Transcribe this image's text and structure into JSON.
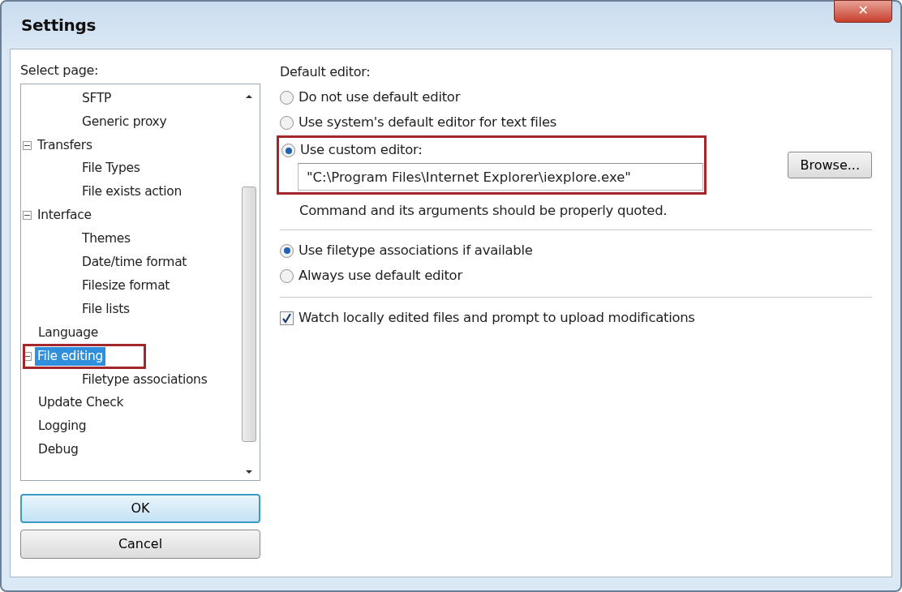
{
  "window": {
    "title": "Settings",
    "close_glyph": "✕"
  },
  "sidebar": {
    "label": "Select page:",
    "items": [
      {
        "children": [
          {
            "label": "SFTP",
            "selected": false
          },
          {
            "label": "Generic proxy",
            "selected": false
          }
        ]
      },
      {
        "label": "Transfers",
        "expanded": true,
        "selected": false,
        "children": [
          {
            "label": "File Types",
            "selected": false
          },
          {
            "label": "File exists action",
            "selected": false
          }
        ]
      },
      {
        "label": "Interface",
        "expanded": true,
        "selected": false,
        "children": [
          {
            "label": "Themes",
            "selected": false
          },
          {
            "label": "Date/time format",
            "selected": false
          },
          {
            "label": "Filesize format",
            "selected": false
          },
          {
            "label": "File lists",
            "selected": false
          }
        ]
      },
      {
        "label": "Language",
        "selected": false
      },
      {
        "label": "File editing",
        "expanded": true,
        "selected": true,
        "children": [
          {
            "label": "Filetype associations",
            "selected": false
          }
        ]
      },
      {
        "label": "Update Check",
        "selected": false
      },
      {
        "label": "Logging",
        "selected": false
      },
      {
        "label": "Debug",
        "selected": false
      }
    ]
  },
  "buttons": [
    {
      "label": "OK",
      "default": true
    },
    {
      "label": "Cancel",
      "default": false
    }
  ],
  "default_editor": {
    "label": "Default editor:",
    "options": [
      {
        "label": "Do not use default editor",
        "selected": false
      },
      {
        "label": "Use system's default editor for text files",
        "selected": false
      },
      {
        "label": "Use custom editor:",
        "selected": true
      }
    ],
    "custom_command": "\"C:\\Program Files\\Internet Explorer\\iexplore.exe\"",
    "browse_button": "Browse...",
    "hint": "Command and its arguments should be properly quoted."
  },
  "association_options": [
    {
      "label": "Use filetype associations if available",
      "selected": true
    },
    {
      "label": "Always use default editor",
      "selected": false
    }
  ],
  "watch_option": {
    "label": "Watch locally edited files and prompt to upload modifications",
    "checked": true
  }
}
